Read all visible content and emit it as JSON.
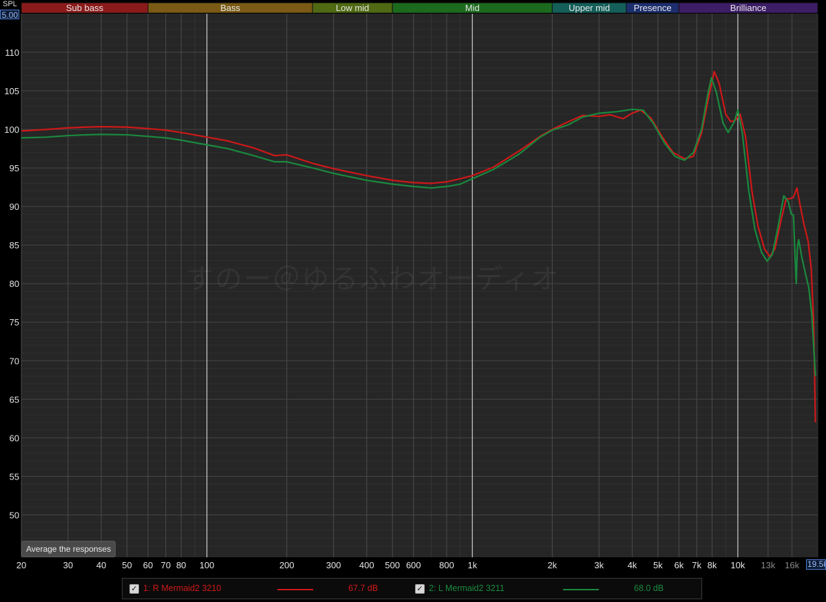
{
  "header": {
    "y_unit_label": "SPL",
    "y_max_value": "5.00",
    "x_max_value": "19.5k"
  },
  "bands": [
    {
      "name": "Sub bass",
      "color": "#8b1a1a",
      "from": 20,
      "to": 60
    },
    {
      "name": "Bass",
      "color": "#7a5a14",
      "from": 60,
      "to": 250
    },
    {
      "name": "Low mid",
      "color": "#4f6a12",
      "from": 250,
      "to": 500
    },
    {
      "name": "Mid",
      "color": "#1c6a1e",
      "from": 500,
      "to": 2000
    },
    {
      "name": "Upper mid",
      "color": "#145f5a",
      "from": 2000,
      "to": 3800
    },
    {
      "name": "Presence",
      "color": "#1d2e6e",
      "from": 3800,
      "to": 6000
    },
    {
      "name": "Brilliance",
      "color": "#3d1d66",
      "from": 6000,
      "to": 20000
    }
  ],
  "watermark": "すのー＠ゆるふわオーディオ",
  "controls": {
    "average_button": "Average the responses"
  },
  "legend": [
    {
      "checked": true,
      "label": "1: R Mermaid2 3210",
      "level": "67.7 dB",
      "color": "#d01818"
    },
    {
      "checked": true,
      "label": "2: L Mermaid2 3211",
      "level": "68.0 dB",
      "color": "#1a8a3e"
    }
  ],
  "chart_data": {
    "type": "line",
    "x_scale": "log",
    "xlim": [
      20,
      20000
    ],
    "ylim": [
      44.5,
      115
    ],
    "grid": true,
    "y_ticks": [
      50,
      55,
      60,
      65,
      70,
      75,
      80,
      85,
      90,
      95,
      100,
      105,
      110
    ],
    "x_ticks": [
      {
        "v": 20,
        "label": "20"
      },
      {
        "v": 30,
        "label": "30"
      },
      {
        "v": 40,
        "label": "40"
      },
      {
        "v": 50,
        "label": "50"
      },
      {
        "v": 60,
        "label": "60"
      },
      {
        "v": 70,
        "label": "70"
      },
      {
        "v": 80,
        "label": "80"
      },
      {
        "v": 100,
        "label": "100"
      },
      {
        "v": 200,
        "label": "200"
      },
      {
        "v": 300,
        "label": "300"
      },
      {
        "v": 400,
        "label": "400"
      },
      {
        "v": 500,
        "label": "500"
      },
      {
        "v": 600,
        "label": "600"
      },
      {
        "v": 800,
        "label": "800"
      },
      {
        "v": 1000,
        "label": "1k"
      },
      {
        "v": 2000,
        "label": "2k"
      },
      {
        "v": 3000,
        "label": "3k"
      },
      {
        "v": 4000,
        "label": "4k"
      },
      {
        "v": 5000,
        "label": "5k"
      },
      {
        "v": 6000,
        "label": "6k"
      },
      {
        "v": 7000,
        "label": "7k"
      },
      {
        "v": 8000,
        "label": "8k"
      },
      {
        "v": 10000,
        "label": "10k"
      },
      {
        "v": 13000,
        "label": "13k",
        "dim": true
      },
      {
        "v": 16000,
        "label": "16k",
        "dim": true
      }
    ],
    "series": [
      {
        "name": "1: R Mermaid2 3210",
        "color": "#d01818",
        "points": [
          [
            20,
            99.8
          ],
          [
            25,
            100.0
          ],
          [
            30,
            100.2
          ],
          [
            35,
            100.3
          ],
          [
            40,
            100.35
          ],
          [
            50,
            100.3
          ],
          [
            60,
            100.1
          ],
          [
            70,
            99.9
          ],
          [
            80,
            99.6
          ],
          [
            100,
            99.0
          ],
          [
            120,
            98.5
          ],
          [
            150,
            97.6
          ],
          [
            180,
            96.6
          ],
          [
            200,
            96.7
          ],
          [
            250,
            95.6
          ],
          [
            300,
            94.9
          ],
          [
            400,
            94.0
          ],
          [
            500,
            93.4
          ],
          [
            600,
            93.1
          ],
          [
            700,
            93.0
          ],
          [
            800,
            93.2
          ],
          [
            900,
            93.6
          ],
          [
            1000,
            94.0
          ],
          [
            1200,
            95.1
          ],
          [
            1500,
            97.2
          ],
          [
            1800,
            99.1
          ],
          [
            2000,
            100.0
          ],
          [
            2300,
            101.0
          ],
          [
            2600,
            101.8
          ],
          [
            3000,
            101.7
          ],
          [
            3300,
            101.9
          ],
          [
            3700,
            101.4
          ],
          [
            4000,
            102.1
          ],
          [
            4300,
            102.5
          ],
          [
            4700,
            101.5
          ],
          [
            5200,
            99.0
          ],
          [
            5700,
            97.0
          ],
          [
            6300,
            96.2
          ],
          [
            6800,
            96.5
          ],
          [
            7300,
            99.5
          ],
          [
            7800,
            104.5
          ],
          [
            8150,
            107.5
          ],
          [
            8500,
            106.0
          ],
          [
            9000,
            102.0
          ],
          [
            9400,
            101.0
          ],
          [
            9800,
            101.2
          ],
          [
            10200,
            102.0
          ],
          [
            10700,
            99.0
          ],
          [
            11300,
            92.0
          ],
          [
            11900,
            87.5
          ],
          [
            12600,
            84.5
          ],
          [
            13200,
            83.5
          ],
          [
            13800,
            84.5
          ],
          [
            14500,
            88.0
          ],
          [
            15200,
            91.0
          ],
          [
            15700,
            91.0
          ],
          [
            16200,
            91.2
          ],
          [
            16700,
            92.4
          ],
          [
            17200,
            90.0
          ],
          [
            17800,
            87.5
          ],
          [
            18400,
            85.5
          ],
          [
            18900,
            82.0
          ],
          [
            19300,
            75.0
          ],
          [
            19600,
            62.0
          ]
        ]
      },
      {
        "name": "2: L Mermaid2 3211",
        "color": "#1a8a3e",
        "points": [
          [
            20,
            98.9
          ],
          [
            25,
            99.0
          ],
          [
            30,
            99.2
          ],
          [
            35,
            99.3
          ],
          [
            40,
            99.35
          ],
          [
            50,
            99.3
          ],
          [
            60,
            99.1
          ],
          [
            70,
            98.9
          ],
          [
            80,
            98.6
          ],
          [
            100,
            98.0
          ],
          [
            120,
            97.5
          ],
          [
            150,
            96.6
          ],
          [
            180,
            95.8
          ],
          [
            200,
            95.8
          ],
          [
            250,
            95.0
          ],
          [
            300,
            94.3
          ],
          [
            400,
            93.4
          ],
          [
            500,
            92.9
          ],
          [
            600,
            92.6
          ],
          [
            700,
            92.4
          ],
          [
            800,
            92.6
          ],
          [
            900,
            92.9
          ],
          [
            1000,
            93.6
          ],
          [
            1200,
            94.8
          ],
          [
            1500,
            96.8
          ],
          [
            1800,
            99.0
          ],
          [
            2000,
            99.9
          ],
          [
            2300,
            100.6
          ],
          [
            2600,
            101.6
          ],
          [
            3000,
            102.1
          ],
          [
            3500,
            102.3
          ],
          [
            4000,
            102.6
          ],
          [
            4400,
            102.5
          ],
          [
            4800,
            100.8
          ],
          [
            5300,
            98.2
          ],
          [
            5800,
            96.5
          ],
          [
            6300,
            96.0
          ],
          [
            6800,
            97.0
          ],
          [
            7300,
            100.0
          ],
          [
            7700,
            104.5
          ],
          [
            7950,
            106.7
          ],
          [
            8300,
            104.8
          ],
          [
            8800,
            100.8
          ],
          [
            9200,
            99.6
          ],
          [
            9700,
            101.0
          ],
          [
            10000,
            102.5
          ],
          [
            10400,
            99.5
          ],
          [
            11000,
            92.0
          ],
          [
            11600,
            87.0
          ],
          [
            12300,
            84.0
          ],
          [
            12900,
            82.9
          ],
          [
            13500,
            83.8
          ],
          [
            14200,
            87.5
          ],
          [
            14900,
            91.4
          ],
          [
            15500,
            90.6
          ],
          [
            15900,
            89.0
          ],
          [
            16200,
            88.9
          ],
          [
            16450,
            83.0
          ],
          [
            16600,
            80.0
          ],
          [
            16750,
            84.5
          ],
          [
            16950,
            85.7
          ],
          [
            17400,
            83.5
          ],
          [
            18000,
            81.2
          ],
          [
            18500,
            79.5
          ],
          [
            19000,
            76.0
          ],
          [
            19600,
            68.0
          ]
        ]
      }
    ]
  }
}
